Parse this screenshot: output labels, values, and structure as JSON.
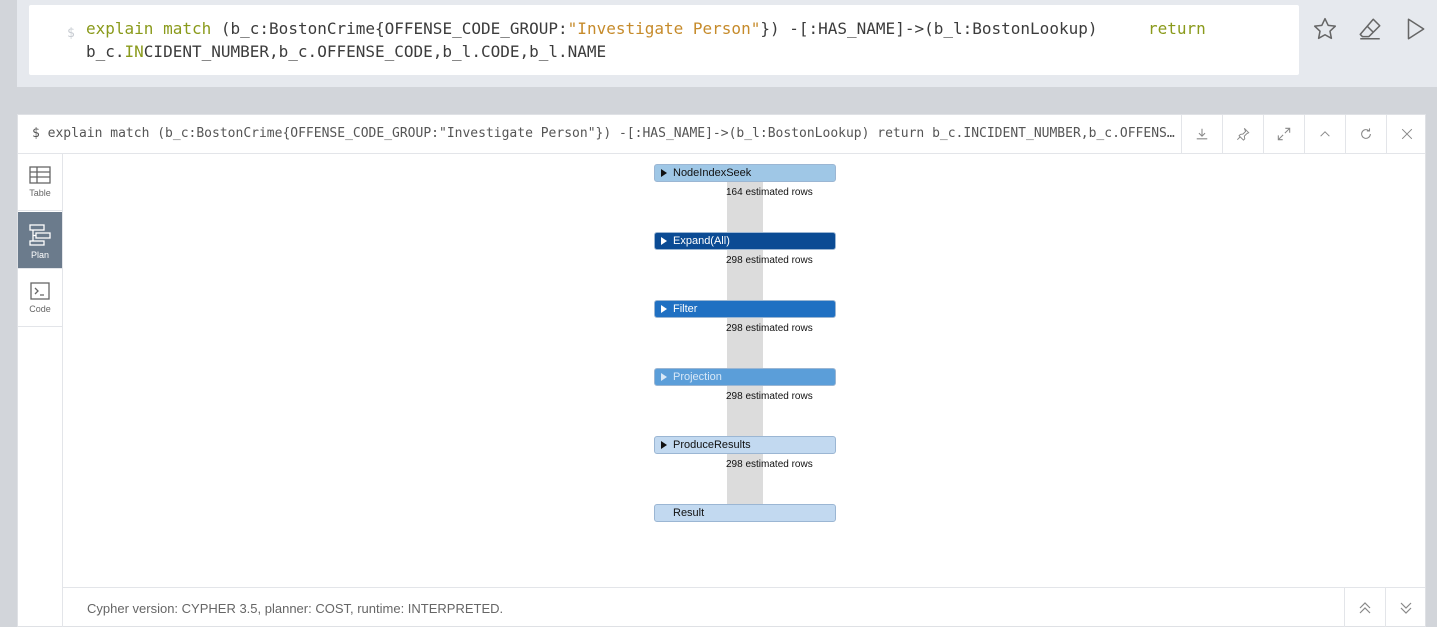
{
  "editor": {
    "prompt": "$",
    "query_parts": {
      "kw1": "explain",
      "kw2": "match",
      "pattern_a": " (b_c:BostonCrime{OFFENSE_CODE_GROUP:",
      "string": "\"Investigate Person\"",
      "pattern_b": "}) -[:HAS_NAME]->(b_l:BostonLookup)",
      "return_kw": "return",
      "line2_a": "b_c.",
      "line2_kw": "IN",
      "line2_b": "CIDENT_NUMBER,b_c.OFFENSE_CODE,b_l.CODE,b_l.NAME"
    },
    "actions": [
      "star-icon",
      "eraser-icon",
      "play-icon"
    ]
  },
  "frame": {
    "title": "$ explain match (b_c:BostonCrime{OFFENSE_CODE_GROUP:\"Investigate Person\"}) -[:HAS_NAME]->(b_l:BostonLookup) return b_c.INCIDENT_NUMBER,b_c.OFFENSE_CODE,b_l.CODE,b_l.NAME",
    "header_buttons": [
      "download-icon",
      "pin-icon",
      "expand-icon",
      "collapse-up-icon",
      "refresh-icon",
      "close-icon"
    ]
  },
  "sidebar": {
    "tabs": [
      {
        "label": "Table",
        "icon": "table-icon",
        "active": false
      },
      {
        "label": "Plan",
        "icon": "plan-icon",
        "active": true
      },
      {
        "label": "Code",
        "icon": "code-icon",
        "active": false
      }
    ]
  },
  "plan": {
    "operators": [
      {
        "name": "NodeIndexSeek",
        "rows": "164 estimated rows",
        "color": "#9fc7e6",
        "text_color": "#111111"
      },
      {
        "name": "Expand(All)",
        "rows": "298 estimated rows",
        "color": "#0b4b94",
        "text_color": "#ffffff"
      },
      {
        "name": "Filter",
        "rows": "298 estimated rows",
        "color": "#2070c2",
        "text_color": "#ffffff"
      },
      {
        "name": "Projection",
        "rows": "298 estimated rows",
        "color": "#5b9ed9",
        "text_color": "#d8e8f7"
      },
      {
        "name": "ProduceResults",
        "rows": "298 estimated rows",
        "color": "#c2d9f0",
        "text_color": "#111111"
      },
      {
        "name": "Result",
        "rows": "",
        "color": "#c2d9f0",
        "text_color": "#111111"
      }
    ]
  },
  "footer": {
    "text": "Cypher version: CYPHER 3.5, planner: COST, runtime: INTERPRETED."
  }
}
